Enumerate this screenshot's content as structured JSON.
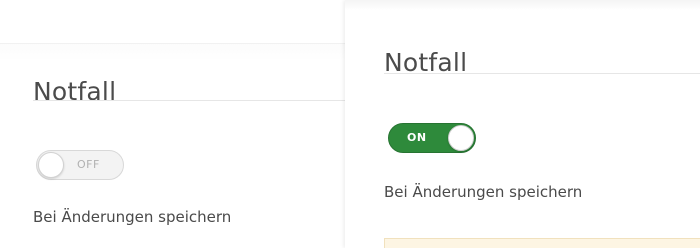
{
  "panels": [
    {
      "title": "Notfall",
      "toggle": {
        "state_label": "OFF",
        "checked": false
      },
      "label": "Bei Änderungen speichern"
    },
    {
      "title": "Notfall",
      "toggle": {
        "state_label": "ON",
        "checked": true,
        "accent": "#2e8a3b"
      },
      "label": "Bei Änderungen speichern"
    }
  ]
}
